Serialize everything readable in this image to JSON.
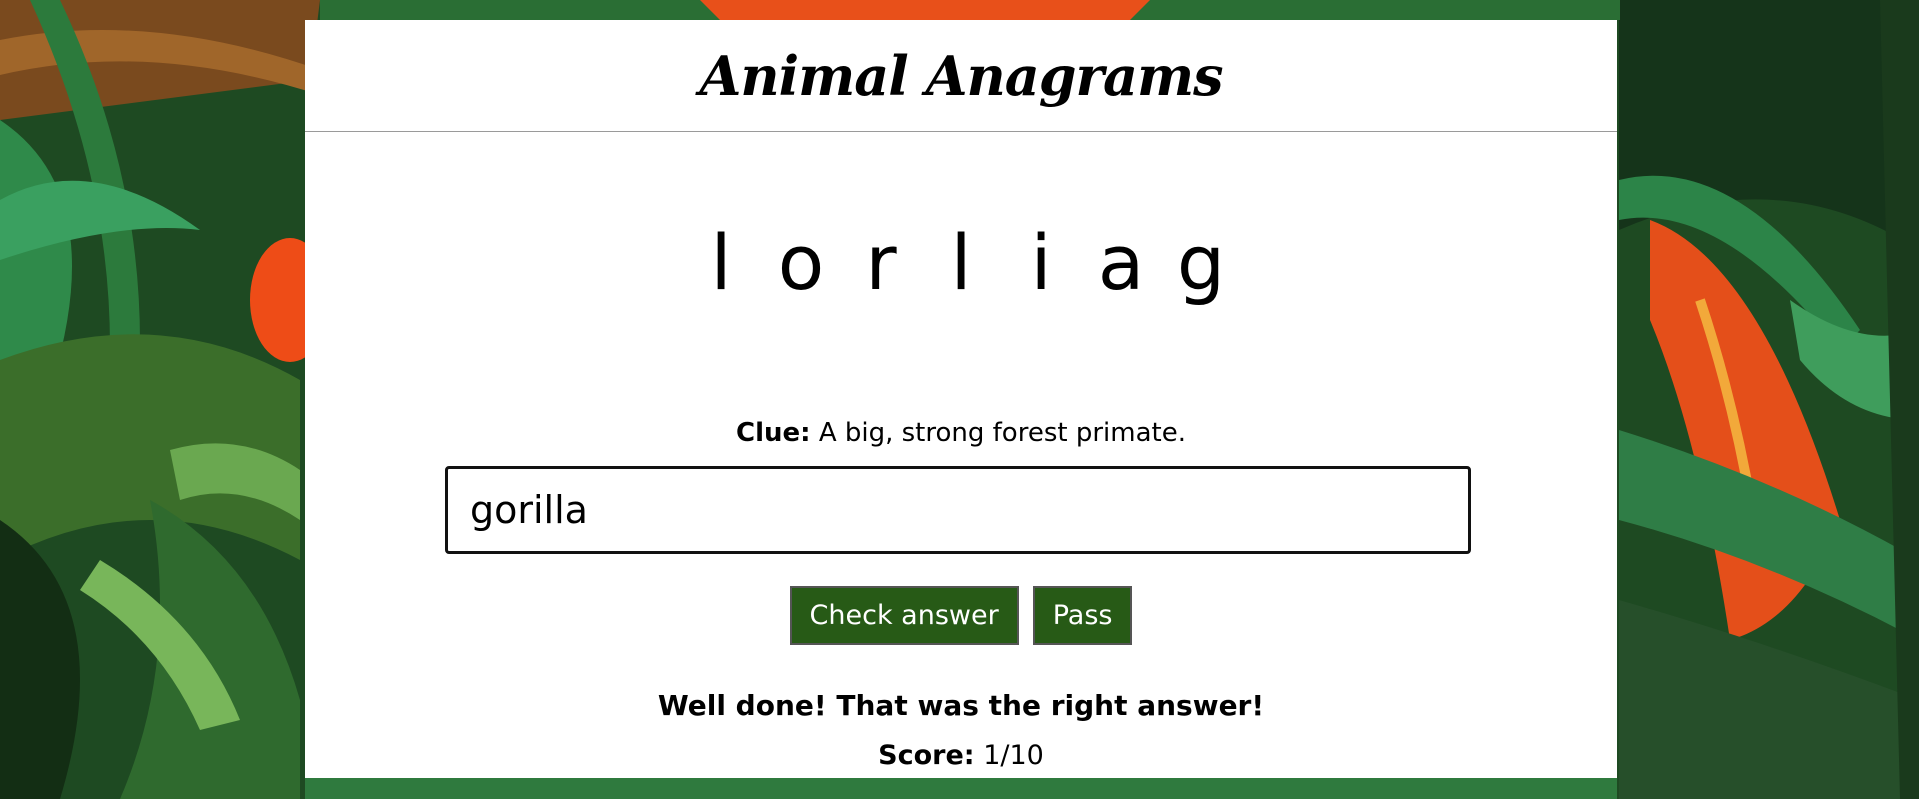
{
  "header": {
    "title": "Animal Anagrams"
  },
  "scramble": {
    "letters": [
      "l",
      "o",
      "r",
      "l",
      "i",
      "a",
      "g"
    ]
  },
  "clue": {
    "label": "Clue:",
    "text": "A big, strong forest primate."
  },
  "answer": {
    "value": "gorilla",
    "placeholder": ""
  },
  "actions": {
    "check_label": "Check answer",
    "pass_label": "Pass"
  },
  "feedback": {
    "message": "Well done! That was the right answer!"
  },
  "score": {
    "label": "Score:",
    "value": "1/10"
  },
  "colors": {
    "button": "#275a16",
    "card": "#ffffff",
    "leaf_dark": "#1f4a24",
    "accent_orange": "#e8501a"
  }
}
